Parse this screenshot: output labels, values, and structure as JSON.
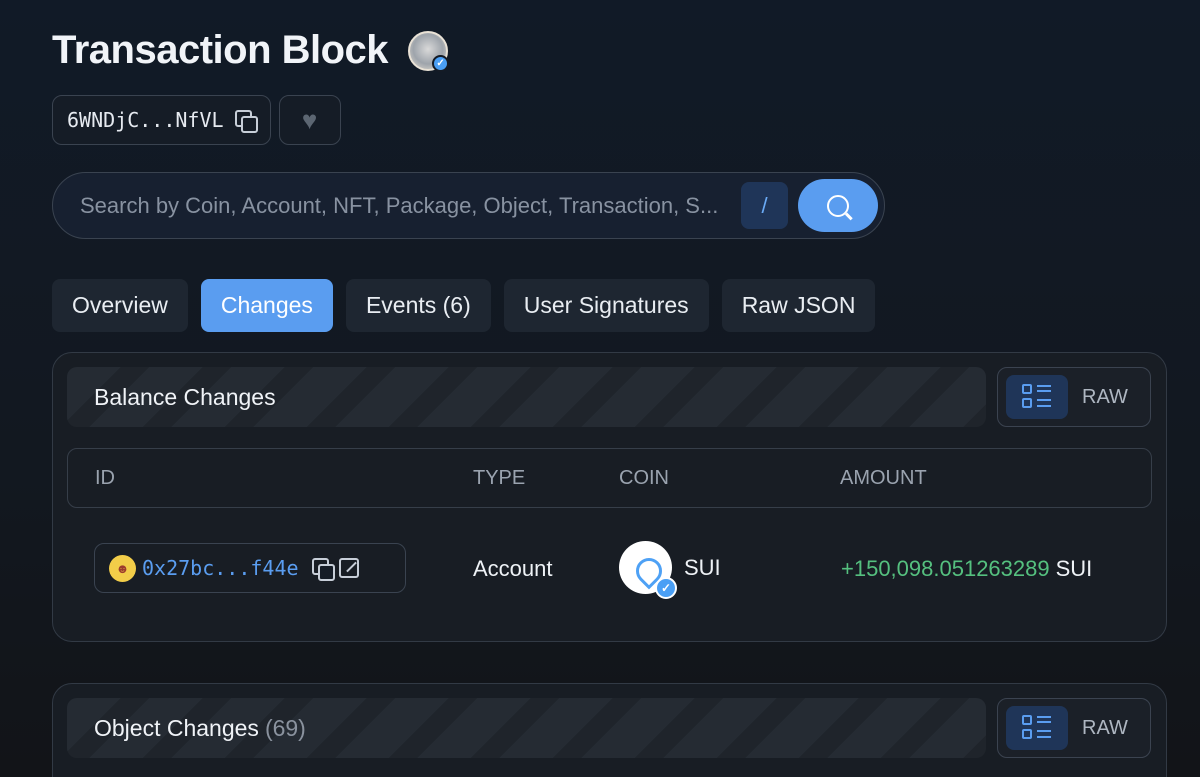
{
  "header": {
    "title": "Transaction Block",
    "avatar": "whale-avatar"
  },
  "hash": {
    "short": "6WNDjC...NfVL"
  },
  "search": {
    "placeholder": "Search by Coin, Account, NFT, Package, Object, Transaction, S...",
    "shortcut": "/"
  },
  "tabs": [
    {
      "label": "Overview"
    },
    {
      "label": "Changes",
      "active": true
    },
    {
      "label": "Events (6)"
    },
    {
      "label": "User Signatures"
    },
    {
      "label": "Raw JSON"
    }
  ],
  "balance_changes": {
    "title": "Balance Changes",
    "raw_label": "RAW",
    "columns": {
      "id": "ID",
      "type": "TYPE",
      "coin": "COIN",
      "amount": "AMOUNT"
    },
    "rows": [
      {
        "address": "0x27bc...f44e",
        "type": "Account",
        "coin": "SUI",
        "amount": "+150,098.051263289",
        "unit": "SUI"
      }
    ]
  },
  "object_changes": {
    "title": "Object Changes",
    "count": "(69)",
    "raw_label": "RAW"
  },
  "colors": {
    "accent": "#5a9df0",
    "positive": "#55c07f",
    "background": "#121820"
  }
}
